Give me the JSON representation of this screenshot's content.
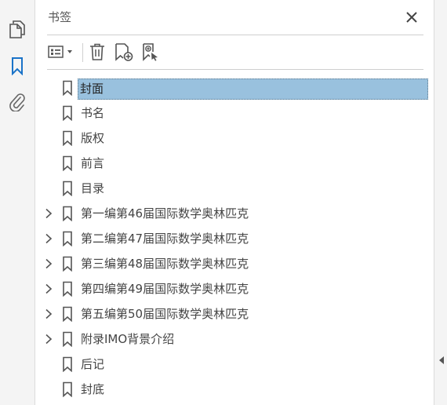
{
  "panel": {
    "title": "书签",
    "close_label": "✕"
  },
  "toolstrip": {
    "icons": [
      "pages-icon",
      "bookmark-icon",
      "attachment-icon"
    ]
  },
  "toolbar": {
    "icons": [
      "options-icon",
      "delete-icon",
      "new-bookmark-icon",
      "bookmark-from-structure-icon"
    ]
  },
  "bookmarks": [
    {
      "label": "封面",
      "expandable": false,
      "selected": true
    },
    {
      "label": "书名",
      "expandable": false,
      "selected": false
    },
    {
      "label": "版权",
      "expandable": false,
      "selected": false
    },
    {
      "label": "前言",
      "expandable": false,
      "selected": false
    },
    {
      "label": "目录",
      "expandable": false,
      "selected": false
    },
    {
      "label": "第一编第46届国际数学奥林匹克",
      "expandable": true,
      "selected": false
    },
    {
      "label": "第二编第47届国际数学奥林匹克",
      "expandable": true,
      "selected": false
    },
    {
      "label": "第三编第48届国际数学奥林匹克",
      "expandable": true,
      "selected": false
    },
    {
      "label": "第四编第49届国际数学奥林匹克",
      "expandable": true,
      "selected": false
    },
    {
      "label": "第五编第50届国际数学奥林匹克",
      "expandable": true,
      "selected": false
    },
    {
      "label": "附录IMO背景介绍",
      "expandable": true,
      "selected": false
    },
    {
      "label": "后记",
      "expandable": false,
      "selected": false
    },
    {
      "label": "封底",
      "expandable": false,
      "selected": false
    }
  ],
  "colors": {
    "accent": "#1a73c8",
    "selection": "#99c1de",
    "icon": "#555555"
  }
}
